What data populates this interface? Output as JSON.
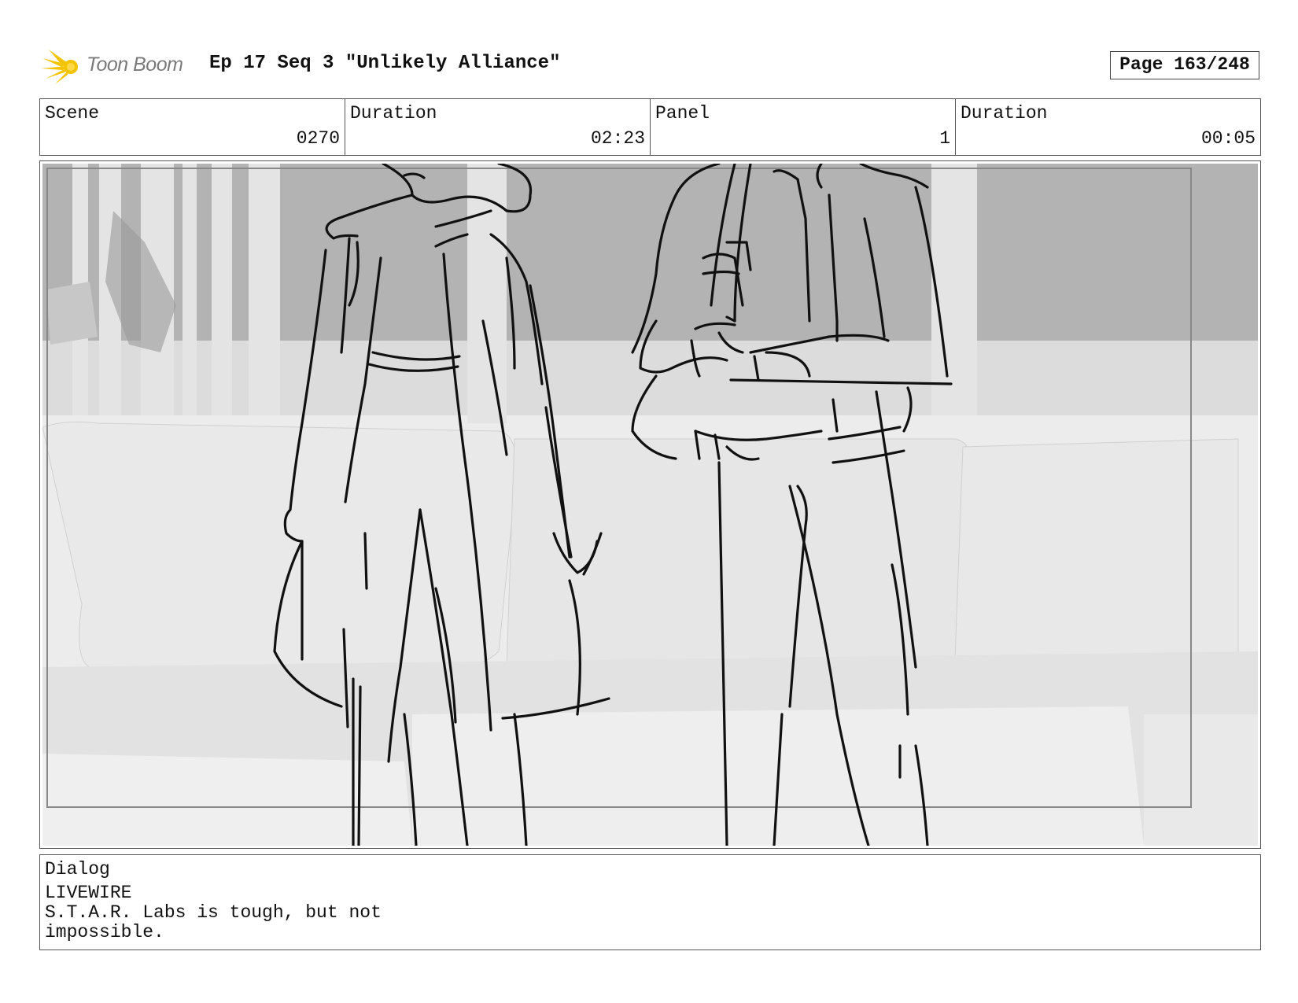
{
  "header": {
    "logo_text": "Toon Boom",
    "title": "Ep 17 Seq 3 \"Unlikely Alliance\"",
    "page": "Page 163/248"
  },
  "info": {
    "scene": {
      "label": "Scene",
      "value": "0270"
    },
    "duration": {
      "label": "Duration",
      "value": "02:23"
    },
    "panel": {
      "label": "Panel",
      "value": "1"
    },
    "panel_duration": {
      "label": "Duration",
      "value": "00:05"
    }
  },
  "dialog": {
    "label": "Dialog",
    "lines": [
      "LIVEWIRE",
      "S.T.A.R. Labs is tough, but not",
      "impossible."
    ]
  },
  "colors": {
    "logo_star": "#f5c400",
    "background_wall": "#b3b3b3",
    "couch": "#e6e6e6",
    "sketch_line": "#111111"
  }
}
